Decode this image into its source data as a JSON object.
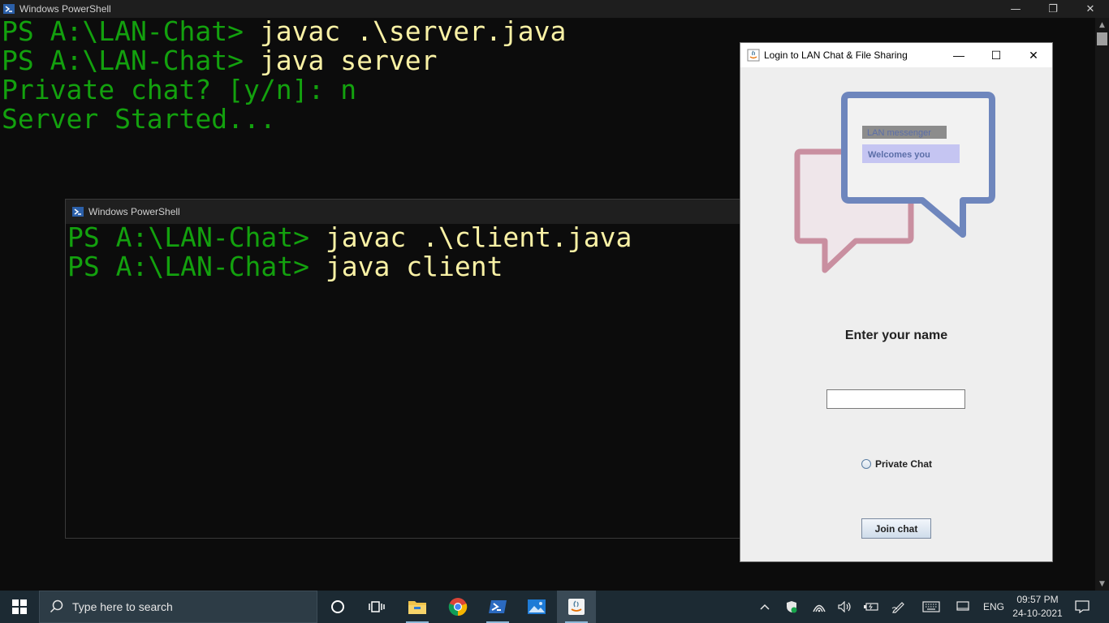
{
  "main_window": {
    "title": "Windows PowerShell",
    "controls": {
      "minimize": "—",
      "restore": "❐",
      "close": "✕"
    },
    "lines": [
      {
        "prompt": "PS A:\\LAN-Chat> ",
        "command": "javac .\\server.java"
      },
      {
        "prompt": "PS A:\\LAN-Chat> ",
        "command": "java server"
      },
      {
        "output": "Private chat? [y/n]: n"
      },
      {
        "output": "Server Started..."
      }
    ]
  },
  "second_window": {
    "title": "Windows PowerShell",
    "lines": [
      {
        "prompt": "PS A:\\LAN-Chat> ",
        "command": "javac .\\client.java"
      },
      {
        "prompt": "PS A:\\LAN-Chat> ",
        "command": "java client"
      }
    ]
  },
  "login_dialog": {
    "title": "Login to LAN Chat & File Sharing",
    "controls": {
      "minimize": "—",
      "maximize": "☐",
      "close": "✕"
    },
    "bubble_text_1": "LAN messenger",
    "bubble_text_2": "Welcomes you",
    "name_label": "Enter your name",
    "name_value": "",
    "private_chat_label": "Private Chat",
    "private_chat_checked": false,
    "join_button": "Join chat"
  },
  "taskbar": {
    "search_placeholder": "Type here to search",
    "language": "ENG",
    "time": "09:57 PM",
    "date": "24-10-2021",
    "pinned": [
      "cortana-icon",
      "task-view-icon",
      "file-explorer-icon",
      "chrome-icon",
      "powershell-icon",
      "photos-icon",
      "java-icon"
    ]
  }
}
